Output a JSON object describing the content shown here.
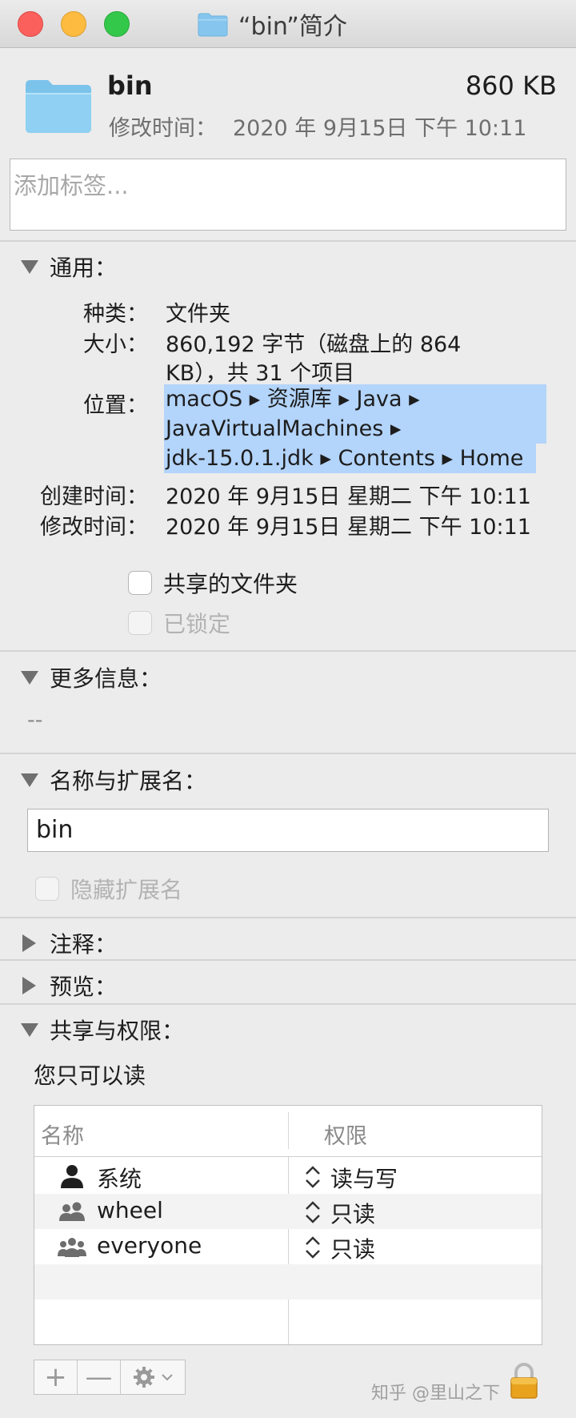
{
  "window": {
    "title": "“bin”简介"
  },
  "header": {
    "name": "bin",
    "size": "860 KB",
    "modified_label": "修改时间：",
    "modified_value": "2020 年 9月15日 下午 10:11"
  },
  "tags": {
    "placeholder": "添加标签..."
  },
  "general": {
    "heading": "通用：",
    "kind_label": "种类：",
    "kind_value": "文件夹",
    "size_label": "大小：",
    "size_value_line1": "860,192 字节（磁盘上的 864",
    "size_value_line2": "KB），共 31 个项目",
    "where_label": "位置：",
    "where_lines": [
      "macOS ▸ 资源库 ▸ Java ▸",
      "JavaVirtualMachines ▸",
      "jdk-15.0.1.jdk ▸ Contents ▸ Home"
    ],
    "created_label": "创建时间：",
    "created_value": "2020 年 9月15日 星期二 下午 10:11",
    "modified_label": "修改时间：",
    "modified_value": "2020 年 9月15日 星期二 下午 10:11",
    "shared_folder_label": "共享的文件夹",
    "locked_label": "已锁定"
  },
  "more_info": {
    "heading": "更多信息：",
    "value": "--"
  },
  "name_ext": {
    "heading": "名称与扩展名：",
    "value": "bin",
    "hide_ext_label": "隐藏扩展名"
  },
  "comments": {
    "heading": "注释："
  },
  "preview": {
    "heading": "预览："
  },
  "sharing": {
    "heading": "共享与权限：",
    "status": "您只可以读",
    "col_name": "名称",
    "col_perm": "权限",
    "rows": [
      {
        "name": "系统",
        "perm": "读与写",
        "icon": "user-icon"
      },
      {
        "name": "wheel",
        "perm": "只读",
        "icon": "group-icon"
      },
      {
        "name": "everyone",
        "perm": "只读",
        "icon": "everyone-icon"
      }
    ]
  },
  "toolbar": {
    "add": "+",
    "remove": "—"
  },
  "watermark": "知乎 @里山之下",
  "colors": {
    "selection": "#b3d4fb",
    "folder": "#7cc3ec",
    "bg": "#ececec"
  }
}
